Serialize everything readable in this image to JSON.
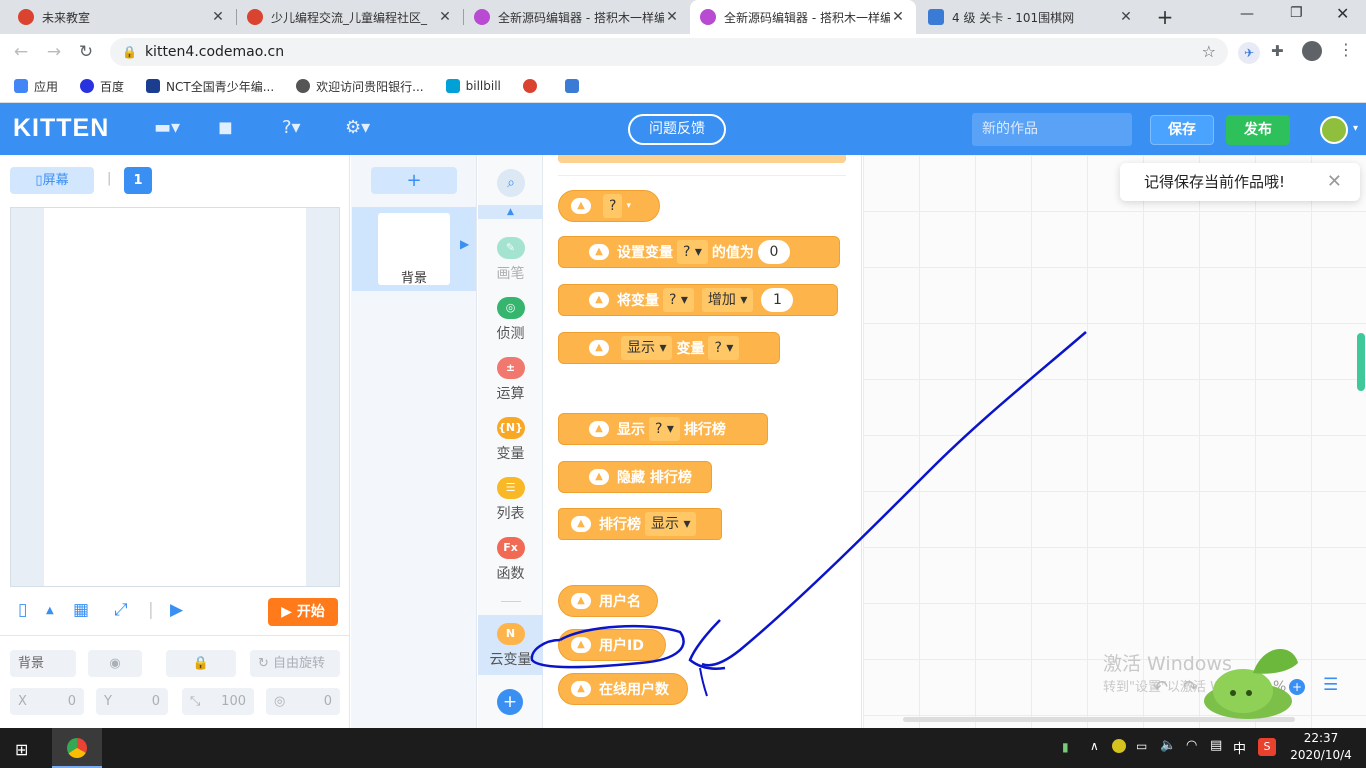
{
  "browser": {
    "tabs": [
      {
        "title": "未来教室",
        "color": "#d9432f"
      },
      {
        "title": "少儿编程交流_儿童编程社区_",
        "color": "#d9432f"
      },
      {
        "title": "全新源码编辑器 - 搭积木一样编",
        "color": "#b84bd1"
      },
      {
        "title": "全新源码编辑器 - 搭积木一样编",
        "color": "#b84bd1"
      },
      {
        "title": "4 级 关卡 - 101围棋网",
        "color": "#3a7bd5"
      }
    ],
    "new_tab": "+",
    "url": "kitten4.codemao.cn",
    "bookmarks": [
      {
        "label": "应用",
        "color": "#4285f4"
      },
      {
        "label": "百度",
        "color": "#2932e1"
      },
      {
        "label": "NCT全国青少年编...",
        "color": "#1a3d8f"
      },
      {
        "label": "欢迎访问贵阳银行...",
        "color": "#555555"
      },
      {
        "label": "billbill",
        "color": "#00a1d6"
      },
      {
        "label": "",
        "color": "#d9432f"
      },
      {
        "label": "",
        "color": "#3a7bd5"
      }
    ]
  },
  "header": {
    "logo": "KITTEN",
    "feedback": "问题反馈",
    "work_name_placeholder": "新的作品",
    "save": "保存",
    "publish": "发布"
  },
  "stage_panel": {
    "screen_button": "屏幕",
    "screen_number": "1",
    "start": "开始",
    "sprite_name": "背景",
    "rotate": "自由旋转",
    "x_label": "X",
    "x_value": "0",
    "y_label": "Y",
    "y_value": "0",
    "size_value": "100",
    "direction_value": "0"
  },
  "sprites": {
    "add": "+",
    "background_label": "背景"
  },
  "categories": [
    {
      "label": "画笔",
      "icon": "pen-icon",
      "color": "#3fc99a",
      "glyph": "✎"
    },
    {
      "label": "侦测",
      "icon": "detect-icon",
      "color": "#35b56e",
      "glyph": "◎"
    },
    {
      "label": "运算",
      "icon": "math-icon",
      "color": "#f0786e",
      "glyph": "±"
    },
    {
      "label": "变量",
      "icon": "variable-icon",
      "color": "#f9a826",
      "glyph": "{N}"
    },
    {
      "label": "列表",
      "icon": "list-icon",
      "color": "#f9b826",
      "glyph": "☰"
    },
    {
      "label": "函数",
      "icon": "function-icon",
      "color": "#f06a54",
      "glyph": "Fx"
    },
    {
      "label": "云变量",
      "icon": "cloud-variable-icon",
      "color": "#fdb54b",
      "glyph": "N"
    }
  ],
  "blocks": {
    "reporter_q": "?",
    "set_var": {
      "text1": "设置变量",
      "dd": "?",
      "text2": "的值为",
      "value": "0"
    },
    "change_var": {
      "text1": "将变量",
      "dd": "?",
      "dd2": "增加",
      "value": "1"
    },
    "show_var": {
      "dd": "显示",
      "text": "变量",
      "dd2": "?"
    },
    "show_rank": {
      "text1": "显示",
      "dd": "?",
      "text2": "排行榜"
    },
    "hide_rank": {
      "text": "隐藏 排行榜"
    },
    "rank_bool": {
      "text": "排行榜",
      "dd": "显示"
    },
    "username": "用户名",
    "userid": "用户ID",
    "online": "在线用户数"
  },
  "workspace": {
    "toast": "记得保存当前作品哦!",
    "watermark_title": "激活 Windows",
    "watermark_sub": "转到\"设置\"以激活 Windows。",
    "zoom": "%"
  },
  "taskbar": {
    "time": "22:37",
    "date": "2020/10/4",
    "ime": "中"
  },
  "colors": {
    "brand": "#3a8ff2",
    "block": "#fdb54b",
    "annotation": "#0a14c8"
  }
}
